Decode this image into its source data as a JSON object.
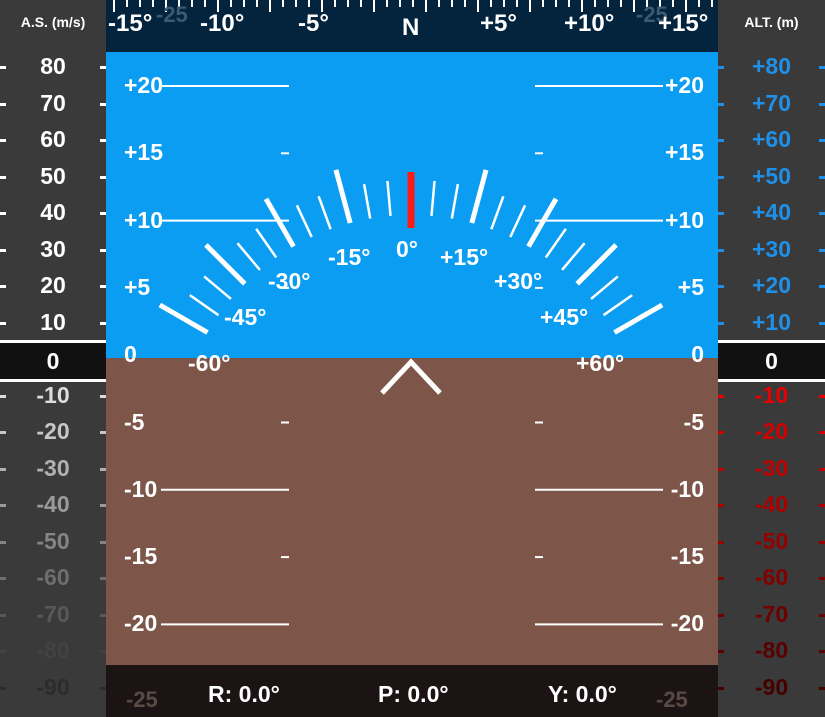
{
  "airspeed": {
    "header": "A.S. (m/s)",
    "current": "0",
    "positive": [
      "80",
      "70",
      "60",
      "50",
      "40",
      "30",
      "20",
      "10"
    ],
    "negative": [
      "-10",
      "-20",
      "-30",
      "-40",
      "-50",
      "-60",
      "-70",
      "-80",
      "-90"
    ]
  },
  "altitude": {
    "header": "ALT. (m)",
    "current": "0",
    "positive": [
      "+80",
      "+70",
      "+60",
      "+50",
      "+40",
      "+30",
      "+20",
      "+10"
    ],
    "negative": [
      "-10",
      "-20",
      "-30",
      "-40",
      "-50",
      "-60",
      "-70",
      "-80",
      "-90"
    ],
    "colors": {
      "positive": "#1e90e8",
      "negative": "#e00000"
    }
  },
  "heading": {
    "labels": [
      "-15°",
      "-10°",
      "-5°",
      "N",
      "+5°",
      "+10°",
      "+15°"
    ]
  },
  "pitch": {
    "left_labels": [
      "+20",
      "+15",
      "+10",
      "+5",
      "0",
      "-5",
      "-10",
      "-15",
      "-20",
      "-25"
    ],
    "right_labels": [
      "+20",
      "+15",
      "+10",
      "+5",
      "0",
      "-5",
      "-10",
      "-15",
      "-20",
      "-25"
    ]
  },
  "roll": {
    "labels": [
      "-60°",
      "-45°",
      "-30°",
      "-15°",
      "0°",
      "+15°",
      "+30°",
      "+45°",
      "+60°"
    ],
    "pointer_color": "#ff1a1a"
  },
  "status": {
    "roll": "R: 0.0°",
    "pitch": "P: 0.0°",
    "yaw": "Y: 0.0°"
  },
  "colors": {
    "sky": "#0a9df2",
    "ground": "#7d5649",
    "heading_bar": "#04233c",
    "tape": "#3a3a3a"
  }
}
